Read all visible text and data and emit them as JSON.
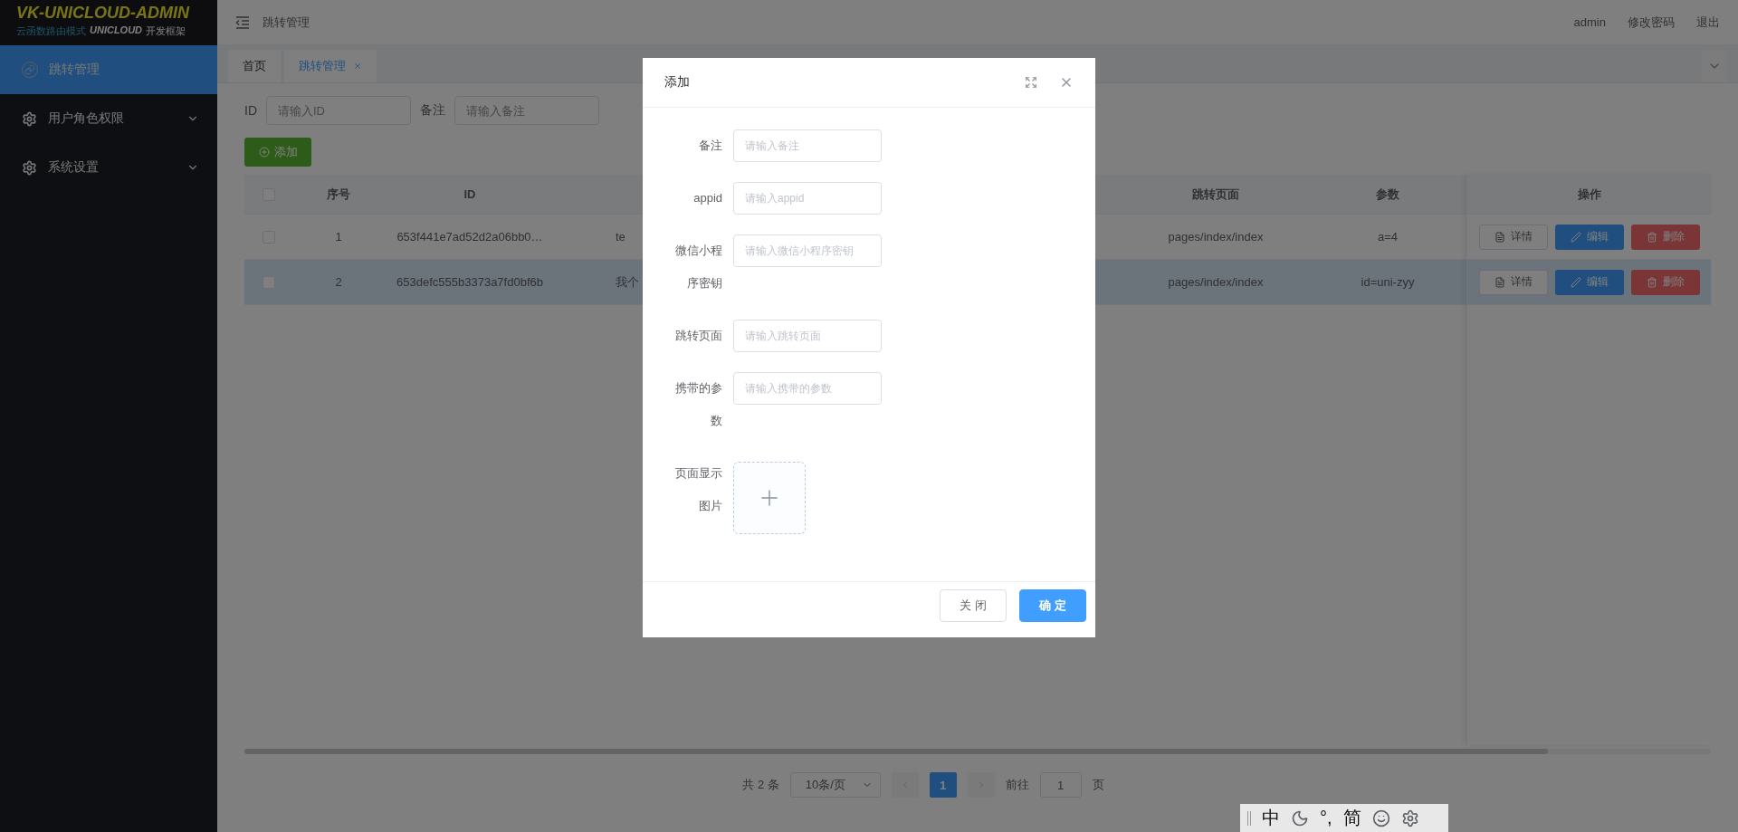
{
  "logo": {
    "title": "VK-UNICLOUD-ADMIN",
    "subtitle": [
      {
        "kind": "mode",
        "text": "云函数路由模式"
      },
      {
        "kind": "brand",
        "text": "UNICLOUD"
      },
      {
        "kind": "plain",
        "text": "开发框架"
      }
    ]
  },
  "sidebar": {
    "items": [
      {
        "label": "跳转管理",
        "kind": "link",
        "selected": true,
        "expandable": false
      },
      {
        "label": "用户角色权限",
        "kind": "gear",
        "selected": false,
        "expandable": true
      },
      {
        "label": "系统设置",
        "kind": "gear",
        "selected": false,
        "expandable": true
      }
    ]
  },
  "header": {
    "breadcrumb": "跳转管理",
    "user_links": [
      "admin",
      "修改密码",
      "退出"
    ]
  },
  "tabs": [
    {
      "label": "首页",
      "selected": false,
      "closable": false
    },
    {
      "label": "跳转管理",
      "selected": true,
      "closable": true
    }
  ],
  "filters": [
    {
      "label": "ID",
      "placeholder": "请输入ID"
    },
    {
      "label": "备注",
      "placeholder": "请输入备注"
    }
  ],
  "add_button": "添加",
  "table": {
    "header_checkbox": {
      "checked": false
    },
    "columns": [
      "序号",
      "ID",
      "",
      "跳转页面",
      "参数"
    ],
    "action_column": "操作",
    "rows": [
      {
        "checked": false,
        "highlighted": false,
        "cells": [
          "1",
          "653f441e7ad52d2a06bb0…",
          "te",
          "pages/index/index",
          "a=4"
        ],
        "actions": [
          {
            "kind": "detail",
            "label": "详情"
          },
          {
            "kind": "edit",
            "label": "编辑"
          },
          {
            "kind": "delete",
            "label": "删除"
          }
        ]
      },
      {
        "checked": false,
        "highlighted": true,
        "cells": [
          "2",
          "653defc555b3373a7fd0bf6b",
          "我个",
          "pages/index/index",
          "id=uni-zyy"
        ],
        "actions": [
          {
            "kind": "detail",
            "label": "详情"
          },
          {
            "kind": "edit",
            "label": "编辑"
          },
          {
            "kind": "delete",
            "label": "删除"
          }
        ]
      }
    ]
  },
  "pagination": {
    "total": "共 2 条",
    "page_size": "10条/页",
    "pages": [
      {
        "label": "1",
        "selected": true
      }
    ],
    "goto_label": "前往",
    "goto_value": "1",
    "goto_suffix": "页"
  },
  "dialog": {
    "title": "添加",
    "fields": [
      {
        "kind": "input",
        "label": [
          "备注"
        ],
        "placeholder": "请输入备注"
      },
      {
        "kind": "input",
        "label": [
          "appid"
        ],
        "placeholder": "请输入appid"
      },
      {
        "kind": "input",
        "label": [
          "微信小程",
          "序密钥"
        ],
        "placeholder": "请输入微信小程序密钥"
      },
      {
        "kind": "input",
        "label": [
          "跳转页面"
        ],
        "placeholder": "请输入跳转页面"
      },
      {
        "kind": "input",
        "label": [
          "携带的参",
          "数"
        ],
        "placeholder": "请输入携带的参数"
      },
      {
        "kind": "upload",
        "label": [
          "页面显示",
          "图片"
        ]
      }
    ],
    "buttons": [
      {
        "kind": "cancel",
        "label": "关 闭"
      },
      {
        "kind": "primary",
        "label": "确 定"
      }
    ]
  },
  "ime_bar": {
    "items": [
      {
        "kind": "text",
        "text": "中"
      },
      {
        "kind": "moon"
      },
      {
        "kind": "text",
        "text": "°,"
      },
      {
        "kind": "text",
        "text": "简"
      },
      {
        "kind": "smile"
      },
      {
        "kind": "gear"
      }
    ]
  }
}
